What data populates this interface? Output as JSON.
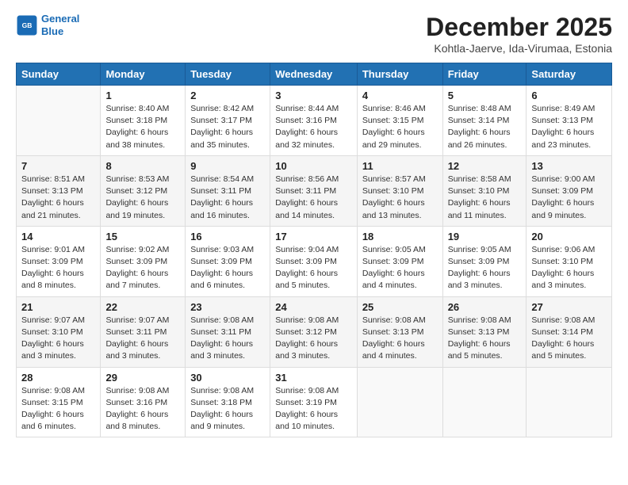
{
  "header": {
    "logo_line1": "General",
    "logo_line2": "Blue",
    "month": "December 2025",
    "location": "Kohtla-Jaerve, Ida-Virumaa, Estonia"
  },
  "days_of_week": [
    "Sunday",
    "Monday",
    "Tuesday",
    "Wednesday",
    "Thursday",
    "Friday",
    "Saturday"
  ],
  "weeks": [
    [
      {
        "day": "",
        "info": ""
      },
      {
        "day": "1",
        "info": "Sunrise: 8:40 AM\nSunset: 3:18 PM\nDaylight: 6 hours\nand 38 minutes."
      },
      {
        "day": "2",
        "info": "Sunrise: 8:42 AM\nSunset: 3:17 PM\nDaylight: 6 hours\nand 35 minutes."
      },
      {
        "day": "3",
        "info": "Sunrise: 8:44 AM\nSunset: 3:16 PM\nDaylight: 6 hours\nand 32 minutes."
      },
      {
        "day": "4",
        "info": "Sunrise: 8:46 AM\nSunset: 3:15 PM\nDaylight: 6 hours\nand 29 minutes."
      },
      {
        "day": "5",
        "info": "Sunrise: 8:48 AM\nSunset: 3:14 PM\nDaylight: 6 hours\nand 26 minutes."
      },
      {
        "day": "6",
        "info": "Sunrise: 8:49 AM\nSunset: 3:13 PM\nDaylight: 6 hours\nand 23 minutes."
      }
    ],
    [
      {
        "day": "7",
        "info": "Sunrise: 8:51 AM\nSunset: 3:13 PM\nDaylight: 6 hours\nand 21 minutes."
      },
      {
        "day": "8",
        "info": "Sunrise: 8:53 AM\nSunset: 3:12 PM\nDaylight: 6 hours\nand 19 minutes."
      },
      {
        "day": "9",
        "info": "Sunrise: 8:54 AM\nSunset: 3:11 PM\nDaylight: 6 hours\nand 16 minutes."
      },
      {
        "day": "10",
        "info": "Sunrise: 8:56 AM\nSunset: 3:11 PM\nDaylight: 6 hours\nand 14 minutes."
      },
      {
        "day": "11",
        "info": "Sunrise: 8:57 AM\nSunset: 3:10 PM\nDaylight: 6 hours\nand 13 minutes."
      },
      {
        "day": "12",
        "info": "Sunrise: 8:58 AM\nSunset: 3:10 PM\nDaylight: 6 hours\nand 11 minutes."
      },
      {
        "day": "13",
        "info": "Sunrise: 9:00 AM\nSunset: 3:09 PM\nDaylight: 6 hours\nand 9 minutes."
      }
    ],
    [
      {
        "day": "14",
        "info": "Sunrise: 9:01 AM\nSunset: 3:09 PM\nDaylight: 6 hours\nand 8 minutes."
      },
      {
        "day": "15",
        "info": "Sunrise: 9:02 AM\nSunset: 3:09 PM\nDaylight: 6 hours\nand 7 minutes."
      },
      {
        "day": "16",
        "info": "Sunrise: 9:03 AM\nSunset: 3:09 PM\nDaylight: 6 hours\nand 6 minutes."
      },
      {
        "day": "17",
        "info": "Sunrise: 9:04 AM\nSunset: 3:09 PM\nDaylight: 6 hours\nand 5 minutes."
      },
      {
        "day": "18",
        "info": "Sunrise: 9:05 AM\nSunset: 3:09 PM\nDaylight: 6 hours\nand 4 minutes."
      },
      {
        "day": "19",
        "info": "Sunrise: 9:05 AM\nSunset: 3:09 PM\nDaylight: 6 hours\nand 3 minutes."
      },
      {
        "day": "20",
        "info": "Sunrise: 9:06 AM\nSunset: 3:10 PM\nDaylight: 6 hours\nand 3 minutes."
      }
    ],
    [
      {
        "day": "21",
        "info": "Sunrise: 9:07 AM\nSunset: 3:10 PM\nDaylight: 6 hours\nand 3 minutes."
      },
      {
        "day": "22",
        "info": "Sunrise: 9:07 AM\nSunset: 3:11 PM\nDaylight: 6 hours\nand 3 minutes."
      },
      {
        "day": "23",
        "info": "Sunrise: 9:08 AM\nSunset: 3:11 PM\nDaylight: 6 hours\nand 3 minutes."
      },
      {
        "day": "24",
        "info": "Sunrise: 9:08 AM\nSunset: 3:12 PM\nDaylight: 6 hours\nand 3 minutes."
      },
      {
        "day": "25",
        "info": "Sunrise: 9:08 AM\nSunset: 3:13 PM\nDaylight: 6 hours\nand 4 minutes."
      },
      {
        "day": "26",
        "info": "Sunrise: 9:08 AM\nSunset: 3:13 PM\nDaylight: 6 hours\nand 5 minutes."
      },
      {
        "day": "27",
        "info": "Sunrise: 9:08 AM\nSunset: 3:14 PM\nDaylight: 6 hours\nand 5 minutes."
      }
    ],
    [
      {
        "day": "28",
        "info": "Sunrise: 9:08 AM\nSunset: 3:15 PM\nDaylight: 6 hours\nand 6 minutes."
      },
      {
        "day": "29",
        "info": "Sunrise: 9:08 AM\nSunset: 3:16 PM\nDaylight: 6 hours\nand 8 minutes."
      },
      {
        "day": "30",
        "info": "Sunrise: 9:08 AM\nSunset: 3:18 PM\nDaylight: 6 hours\nand 9 minutes."
      },
      {
        "day": "31",
        "info": "Sunrise: 9:08 AM\nSunset: 3:19 PM\nDaylight: 6 hours\nand 10 minutes."
      },
      {
        "day": "",
        "info": ""
      },
      {
        "day": "",
        "info": ""
      },
      {
        "day": "",
        "info": ""
      }
    ]
  ]
}
